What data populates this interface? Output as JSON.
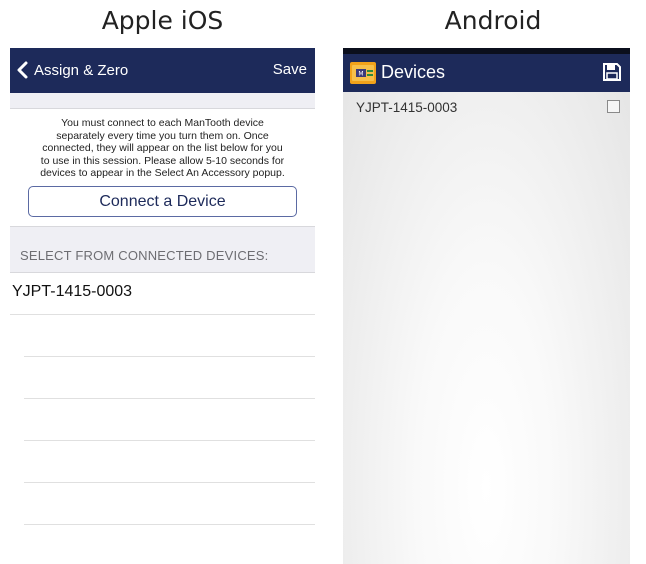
{
  "captions": {
    "ios": "Apple iOS",
    "android": "Android"
  },
  "ios": {
    "nav": {
      "back_label": "Assign & Zero",
      "save_label": "Save"
    },
    "info_lines": [
      "You must connect to each ManTooth device",
      "separately every time you turn them on. Once",
      "connected, they will appear on the list below for you",
      "to use in this session. Please allow 5-10 seconds for",
      "devices to appear in the Select An Accessory popup."
    ],
    "connect_button": "Connect a Device",
    "section_header": "SELECT FROM CONNECTED DEVICES:",
    "devices": [
      "YJPT-1415-0003"
    ],
    "accent": "#1d2a5a"
  },
  "android": {
    "title": "Devices",
    "devices": [
      {
        "name": "YJPT-1415-0003",
        "checked": false
      }
    ],
    "icons": {
      "logo": "app-logo-icon",
      "save": "save-disk-icon",
      "checkbox": "checkbox-icon"
    },
    "accent": "#1d2a5a"
  }
}
